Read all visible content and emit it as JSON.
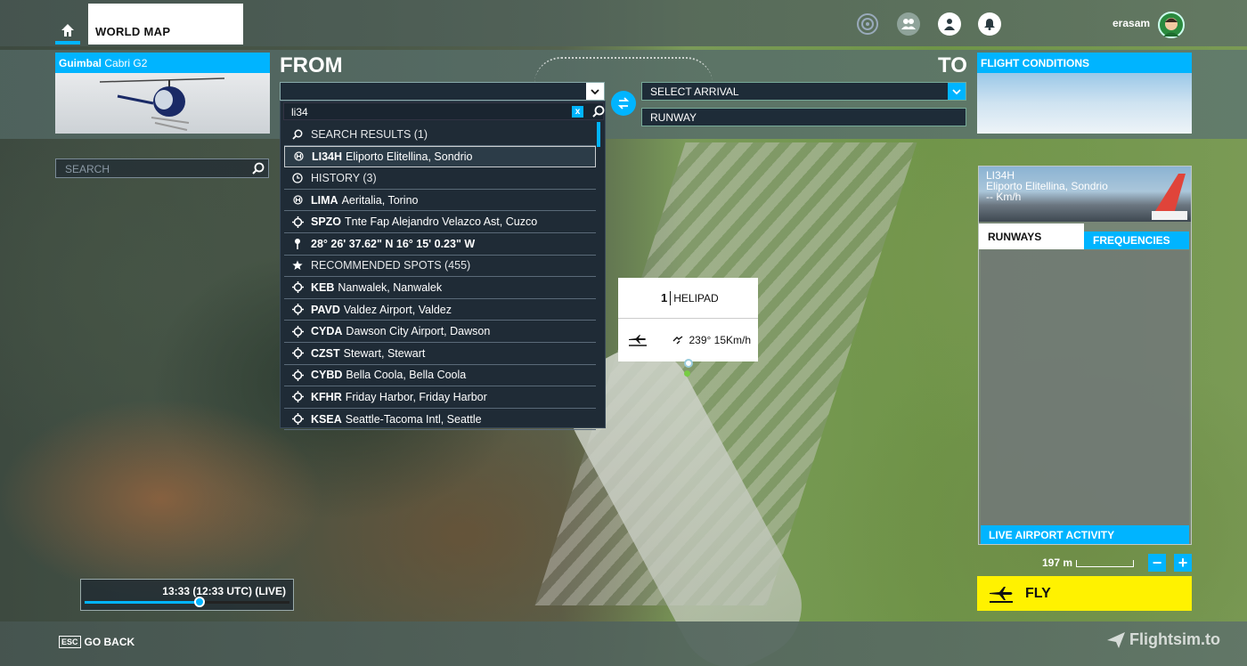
{
  "topbar": {
    "world_map_label": "WORLD MAP",
    "username": "erasam"
  },
  "aircraft": {
    "brand": "Guimbal",
    "model": "Cabri G2"
  },
  "from_label": "FROM",
  "to_label": "TO",
  "search": {
    "query": "li34",
    "clear_label": "x"
  },
  "arrival": {
    "placeholder": "SELECT ARRIVAL",
    "runway": "RUNWAY"
  },
  "flight_conditions_label": "FLIGHT CONDITIONS",
  "results": [
    {
      "kind": "section",
      "icon": "search-icon",
      "text": "SEARCH RESULTS (1)"
    },
    {
      "kind": "item",
      "icon": "heliport-icon",
      "code": "LI34H",
      "name": "Eliporto Elitellina, Sondrio",
      "selected": true
    },
    {
      "kind": "section",
      "icon": "clock-icon",
      "text": "HISTORY (3)"
    },
    {
      "kind": "item",
      "icon": "heliport-icon",
      "code": "LIMA",
      "name": "Aeritalia, Torino"
    },
    {
      "kind": "item",
      "icon": "airport-icon",
      "code": "SPZO",
      "name": "Tnte Fap Alejandro Velazco Ast, Cuzco"
    },
    {
      "kind": "item",
      "icon": "pin-icon",
      "code": "28° 26' 37.62\" N 16° 15' 0.23\" W",
      "name": ""
    },
    {
      "kind": "section",
      "icon": "star-icon",
      "text": "RECOMMENDED SPOTS (455)"
    },
    {
      "kind": "item",
      "icon": "airport-icon",
      "code": "KEB",
      "name": "Nanwalek, Nanwalek"
    },
    {
      "kind": "item",
      "icon": "airport-icon",
      "code": "PAVD",
      "name": "Valdez Airport, Valdez"
    },
    {
      "kind": "item",
      "icon": "airport-icon",
      "code": "CYDA",
      "name": "Dawson City Airport, Dawson"
    },
    {
      "kind": "item",
      "icon": "airport-icon",
      "code": "CZST",
      "name": "Stewart, Stewart"
    },
    {
      "kind": "item",
      "icon": "airport-icon",
      "code": "CYBD",
      "name": "Bella Coola, Bella Coola"
    },
    {
      "kind": "item",
      "icon": "airport-icon",
      "code": "KFHR",
      "name": "Friday Harbor, Friday Harbor"
    },
    {
      "kind": "item",
      "icon": "airport-icon",
      "code": "KSEA",
      "name": "Seattle-Tacoma Intl, Seattle"
    }
  ],
  "map_search_placeholder": "SEARCH",
  "time": {
    "text": "13:33 (12:33 UTC) (LIVE)",
    "progress": 0.56
  },
  "popup": {
    "helipad_count": "1",
    "helipad_label": "HELIPAD",
    "wind": "239° 15Km/h"
  },
  "airport_info": {
    "code": "LI34H",
    "name": "Eliporto Elitellina, Sondrio",
    "distance": "-- Km/h",
    "tab_runways": "RUNWAYS",
    "tab_frequencies": "FREQUENCIES",
    "live_activity": "LIVE AIRPORT ACTIVITY"
  },
  "scale_label": "197 m",
  "zoom_out": "−",
  "zoom_in": "+",
  "fly_label": "FLY",
  "footer": {
    "esc": "ESC",
    "go_back": "GO BACK",
    "brand": "Flightsim.to"
  },
  "colors": {
    "accent": "#00b4ff",
    "fly": "#fff200",
    "panel": "#1f2b36"
  }
}
